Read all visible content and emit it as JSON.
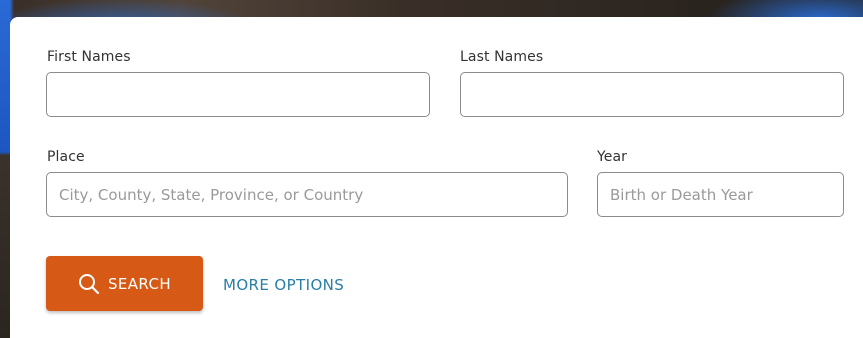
{
  "form": {
    "first_names_label": "First Names",
    "first_names_value": "",
    "last_names_label": "Last Names",
    "last_names_value": "",
    "place_label": "Place",
    "place_placeholder": "City, County, State, Province, or Country",
    "year_label": "Year",
    "year_placeholder": "Birth or Death Year"
  },
  "actions": {
    "search_label": "SEARCH",
    "search_icon": "search-icon",
    "more_options_label": "MORE OPTIONS"
  },
  "colors": {
    "accent": "#d65a16",
    "link": "#2a7da6",
    "border": "#8b8b8b"
  }
}
